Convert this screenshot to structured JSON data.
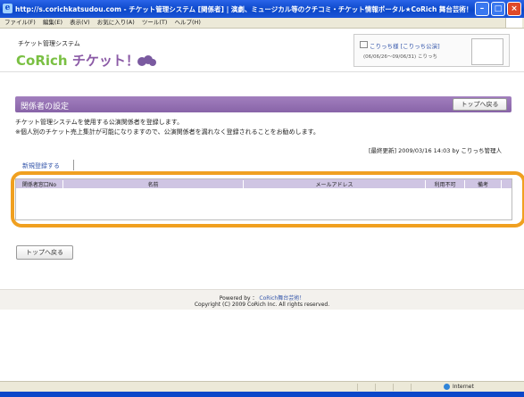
{
  "window": {
    "title": "http://s.corichkatsudou.com - チケット管理システム [関係者] | 演劇、ミュージカル等のクチコミ・チケット情報ポータル★CoRich 舞台芸術！ - Microsoft Inter..."
  },
  "menu": [
    "ファイル(F)",
    "編集(E)",
    "表示(V)",
    "お気に入り(A)",
    "ツール(T)",
    "ヘルプ(H)"
  ],
  "site": {
    "system_label": "チケット管理システム",
    "logo_corich": "CoRich",
    "logo_ticket": "チケット！"
  },
  "user": {
    "name": "こりっち",
    "group": "[こりっち公演]",
    "period": "(06/06/26～09/06/31) こりっち",
    "line1": "こりっち様 [こりっち公演]"
  },
  "header": {
    "title": "関係者の設定",
    "back_button": "トップへ戻る"
  },
  "description": {
    "line1": "チケット管理システムを使用する公演関係者を登録します。",
    "line2": "※個人別のチケット売上集計が可能になりますので、公演関係者を漏れなく登録されることをお勧めします。"
  },
  "last_updated": "[最終更新] 2009/03/16 14:03 by こりっち管理人",
  "new_registration": "新規登録する",
  "table": {
    "columns": [
      "関係者窓口No",
      "名前",
      "メールアドレス",
      "利用不可",
      "備考"
    ]
  },
  "bottom_back_button": "トップへ戻る",
  "footer": {
    "powered_prefix": "Powered by",
    "powered_link": "CoRich舞台芸術！",
    "copyright": "Copyright (C) 2009 CoRich Inc. All rights reserved."
  },
  "statusbar": {
    "zone": "Internet"
  }
}
